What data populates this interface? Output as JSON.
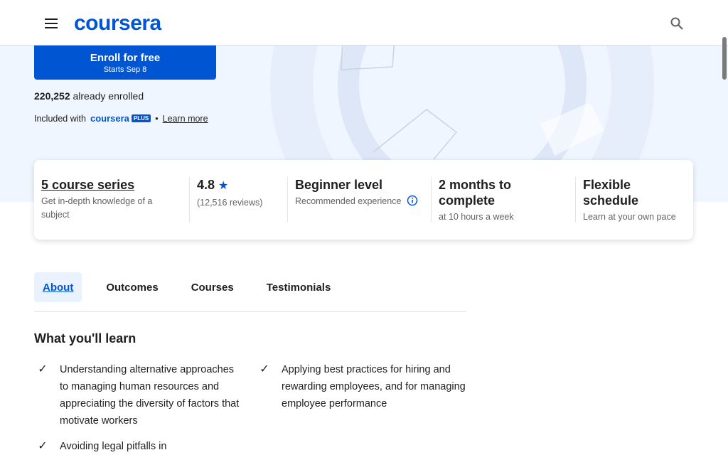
{
  "header": {
    "menu_icon": "menu-icon",
    "logo_text": "coursera",
    "search_icon": "search-icon"
  },
  "hero": {
    "enroll_label": "Enroll for free",
    "enroll_sub": "Starts Sep 8",
    "enrolled_count": "220,252",
    "enrolled_suffix": " already enrolled",
    "included_prefix": "Included with",
    "plus_logo_text": "coursera",
    "plus_badge": "PLUS",
    "bullet": "•",
    "learn_more": "Learn more"
  },
  "info": {
    "series_title": "5 course series",
    "series_sub": "Get in-depth knowledge of a subject",
    "rating": "4.8",
    "reviews": "(12,516 reviews)",
    "level_title": "Beginner level",
    "level_sub": "Recommended experience",
    "duration_title": "2 months to complete",
    "duration_sub": "at 10 hours a week",
    "schedule_title": "Flexible schedule",
    "schedule_sub": "Learn at your own pace"
  },
  "tabs": [
    {
      "label": "About"
    },
    {
      "label": "Outcomes"
    },
    {
      "label": "Courses"
    },
    {
      "label": "Testimonials"
    }
  ],
  "learn": {
    "heading": "What you'll learn",
    "items": [
      "Understanding alternative approaches to managing human resources and appreciating the diversity of factors that motivate workers",
      "Applying best practices for hiring and rewarding employees, and for managing employee performance",
      "Avoiding legal pitfalls in"
    ]
  },
  "colors": {
    "brand": "#0056d2",
    "hero_bg": "#f0f6ff"
  }
}
